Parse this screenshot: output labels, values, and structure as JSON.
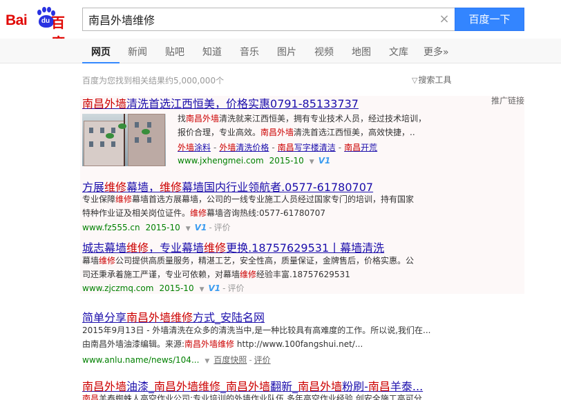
{
  "logo": {
    "part1": "Bai",
    "paw_text": "du",
    "part2": "百度"
  },
  "search": {
    "query": "南昌外墙维修",
    "button_label": "百度一下",
    "clear_glyph": "×"
  },
  "nav": {
    "items": [
      "网页",
      "新闻",
      "贴吧",
      "知道",
      "音乐",
      "图片",
      "视频",
      "地图",
      "文库",
      "更多»"
    ],
    "active": "网页"
  },
  "results_info": {
    "count_text": "百度为您找到相关结果约5,000,000个",
    "tools_label": "搜索工具",
    "ad_label": "推广链接"
  },
  "results": [
    {
      "title_parts": [
        "",
        "南昌外墙",
        "清洗首选江西恒美，价格实惠0791-85133737"
      ],
      "snippet_lines": [
        [
          "找",
          "南昌外墙",
          "清洗就来江西恒美，拥有专业技术人员，经过技术培训，"
        ],
        [
          "报价合理，专业高效。",
          "南昌外墙",
          "清洗首选江西恒美，高效快捷，.."
        ]
      ],
      "sublinks": [
        [
          "",
          "外墙",
          "涂料"
        ],
        [
          "",
          "外墙",
          "清洗价格"
        ],
        [
          "",
          "南昌",
          "写字楼清洁"
        ],
        [
          "",
          "南昌",
          "开荒"
        ]
      ],
      "url": "www.jxhengmei.com",
      "date": "2015-10",
      "badge": "V1"
    },
    {
      "title_parts": [
        "方展",
        "维修",
        "幕墙，",
        "维修",
        "幕墙国内行业领航者.0577-61780707"
      ],
      "snippet_lines": [
        [
          "专业保障",
          "维修",
          "幕墙首选方展幕墙，公司的一线专业施工人员经过国家专门的培训，持有国家"
        ],
        [
          "特种作业证及相关岗位证件。",
          "维修",
          "幕墙咨询热线:0577-61780707"
        ]
      ],
      "url": "www.fz555.cn",
      "date": "2015-10",
      "badge": "V1",
      "eval": "评价"
    },
    {
      "title_parts": [
        "城志幕墙",
        "维修",
        "，专业幕墙",
        "维修",
        "更换.18757629531丨幕墙清洗"
      ],
      "snippet_lines": [
        [
          "幕墙",
          "维修",
          "公司提供高质量服务，精湛工艺，安全性高，质量保证，金牌售后，价格实惠。公"
        ],
        [
          "司还秉承着施工严谨，专业可依赖，对幕墙",
          "维修",
          "经验丰富.18757629531"
        ]
      ],
      "url": "www.zjczmq.com",
      "date": "2015-10",
      "badge": "V1",
      "eval": "评价"
    },
    {
      "title_parts": [
        "简单分享",
        "南昌外墙维修",
        "方式_安陆名网"
      ],
      "snippet_lines": [
        [
          "2015年9月13日 - 外墙清洗在众多的清洗当中,是一种比较具有高难度的工作。所以说,我们在..."
        ],
        [
          "由南昌外墙油漆编辑。来源:",
          "南昌外墙维修",
          " http://www.100fangshui.net/..."
        ]
      ],
      "url": "www.anlu.name/news/104...",
      "cache": "百度快照",
      "eval": "评价"
    },
    {
      "title_parts": [
        "",
        "南昌外墙",
        "油漆_",
        "南昌外墙维修",
        "_",
        "南昌外墙",
        "翻新_",
        "南昌外墙",
        "粉刷-",
        "南昌",
        "羊泰..."
      ],
      "snippet_lines": [
        [
          "",
          "南昌",
          "羊泰蜘蛛人高空作业公司:专业培训的外墙作业队伍,多年高空作业经验,创安全施工高可分"
        ]
      ]
    }
  ]
}
